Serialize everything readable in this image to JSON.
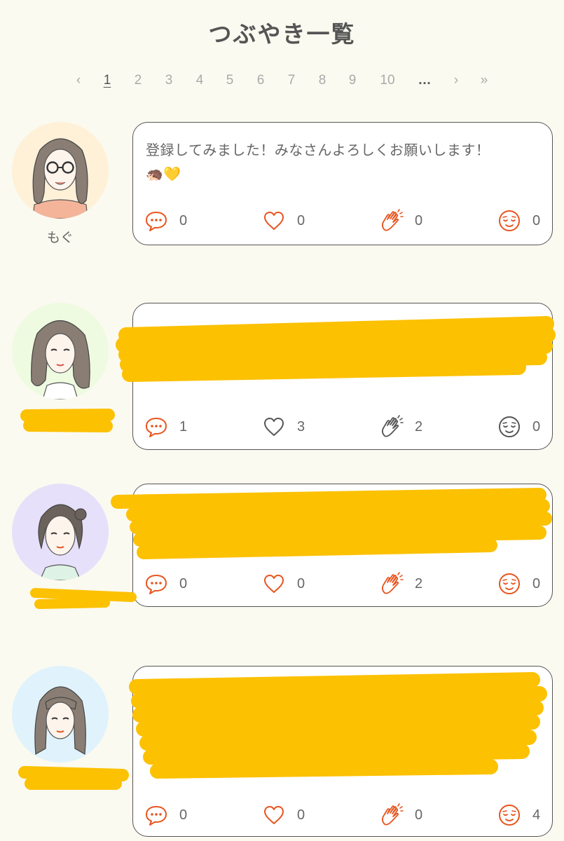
{
  "page": {
    "title": "つぶやき一覧"
  },
  "pagination": {
    "prev": "‹",
    "pages": [
      "1",
      "2",
      "3",
      "4",
      "5",
      "6",
      "7",
      "8",
      "9",
      "10"
    ],
    "current": "1",
    "ellipsis": "…",
    "next": "›",
    "last": "»"
  },
  "colors": {
    "accent": "#e8541e",
    "neutral": "#555555",
    "redaction": "#fcc100",
    "background": "#fbfaf0"
  },
  "posts": [
    {
      "username": "もぐ",
      "text": "登録してみました！みなさんよろしくお願いします！",
      "emoji": "🦔💛",
      "avatar_bg": "#fff0d8",
      "redacted": false,
      "reactions": {
        "comments": "0",
        "likes": "0",
        "claps": "0",
        "relieved": "0"
      },
      "active": true
    },
    {
      "username": "",
      "text": "",
      "avatar_bg": "#eefbe0",
      "redacted": true,
      "reactions": {
        "comments": "1",
        "likes": "3",
        "claps": "2",
        "relieved": "0"
      },
      "active": false
    },
    {
      "username": "",
      "text": "",
      "avatar_bg": "#e6e0fb",
      "redacted": true,
      "reactions": {
        "comments": "0",
        "likes": "0",
        "claps": "2",
        "relieved": "0"
      },
      "active": true
    },
    {
      "username": "",
      "text": "",
      "avatar_bg": "#e0f2fb",
      "redacted": true,
      "reactions": {
        "comments": "0",
        "likes": "0",
        "claps": "0",
        "relieved": "4"
      },
      "active": true
    }
  ]
}
